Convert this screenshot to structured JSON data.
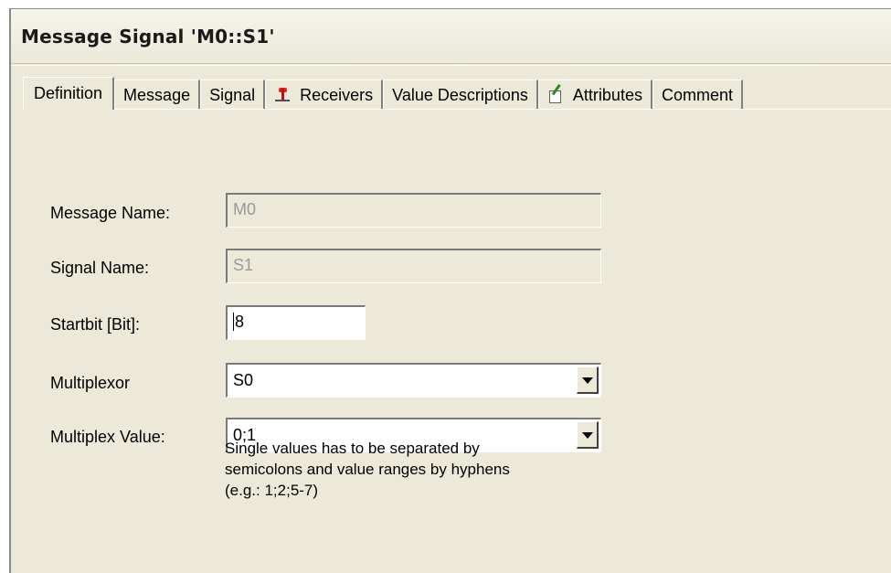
{
  "window": {
    "title": "Message Signal 'M0::S1'"
  },
  "tabs": [
    {
      "label": "Definition",
      "icon": null,
      "active": true
    },
    {
      "label": "Message",
      "icon": null,
      "active": false
    },
    {
      "label": "Signal",
      "icon": null,
      "active": false
    },
    {
      "label": "Receivers",
      "icon": "receiver-icon",
      "active": false
    },
    {
      "label": "Value Descriptions",
      "icon": null,
      "active": false
    },
    {
      "label": "Attributes",
      "icon": "attributes-icon",
      "active": false
    },
    {
      "label": "Comment",
      "icon": null,
      "active": false
    }
  ],
  "form": {
    "message_name": {
      "label": "Message Name:",
      "value": "M0"
    },
    "signal_name": {
      "label": "Signal Name:",
      "value": "S1"
    },
    "startbit": {
      "label": "Startbit [Bit]:",
      "value": "8"
    },
    "multiplexor": {
      "label": "Multiplexor",
      "value": "S0"
    },
    "multiplex_value": {
      "label": "Multiplex Value:",
      "value": "0;1"
    },
    "hint_lines": [
      "Single values has to be separated by",
      "semicolons and value ranges by hyphens",
      "(e.g.: 1;2;5-7)"
    ]
  }
}
